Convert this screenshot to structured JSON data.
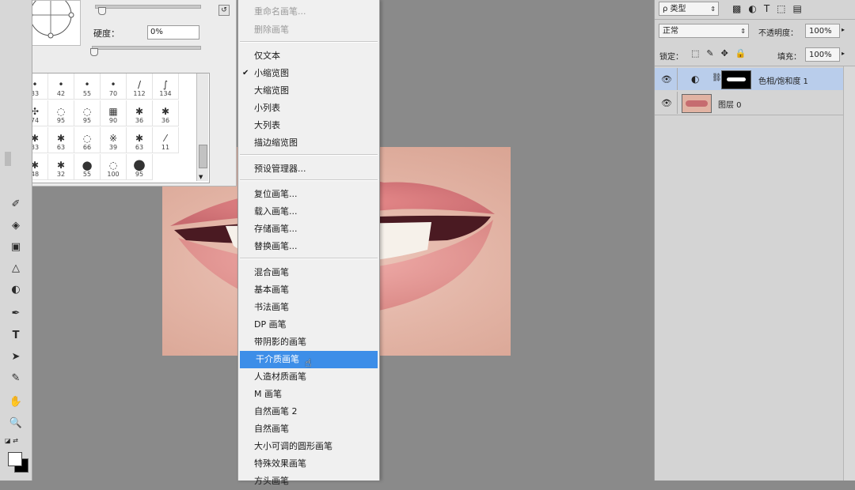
{
  "brush_panel": {
    "hardness_label": "硬度：",
    "hardness_value": "0%",
    "presets": [
      {
        "size": "33",
        "shape": "•"
      },
      {
        "size": "42",
        "shape": "•"
      },
      {
        "size": "55",
        "shape": "•"
      },
      {
        "size": "70",
        "shape": "•"
      },
      {
        "size": "112",
        "shape": "/"
      },
      {
        "size": "134",
        "shape": "∫"
      },
      {
        "size": "74",
        "shape": "✣"
      },
      {
        "size": "95",
        "shape": "◌"
      },
      {
        "size": "95",
        "shape": "◌"
      },
      {
        "size": "90",
        "shape": "▦"
      },
      {
        "size": "36",
        "shape": "✱"
      },
      {
        "size": "36",
        "shape": "✱"
      },
      {
        "size": "33",
        "shape": "✱"
      },
      {
        "size": "63",
        "shape": "✱"
      },
      {
        "size": "66",
        "shape": "◌"
      },
      {
        "size": "39",
        "shape": "※"
      },
      {
        "size": "63",
        "shape": "✱"
      },
      {
        "size": "11",
        "shape": "⁄"
      },
      {
        "size": "48",
        "shape": "✱"
      },
      {
        "size": "32",
        "shape": "✱"
      },
      {
        "size": "55",
        "shape": "●"
      },
      {
        "size": "100",
        "shape": "◌"
      },
      {
        "size": "95",
        "shape": "●"
      }
    ]
  },
  "menu": {
    "items": [
      {
        "label": "重命名画笔...",
        "state": "disabled"
      },
      {
        "label": "删除画笔",
        "state": "disabled"
      },
      {
        "label": "仅文本",
        "state": "normal"
      },
      {
        "label": "小缩览图",
        "state": "checked"
      },
      {
        "label": "大缩览图",
        "state": "normal"
      },
      {
        "label": "小列表",
        "state": "normal"
      },
      {
        "label": "大列表",
        "state": "normal"
      },
      {
        "label": "描边缩览图",
        "state": "normal"
      },
      {
        "label": "预设管理器...",
        "state": "normal"
      },
      {
        "label": "复位画笔...",
        "state": "normal"
      },
      {
        "label": "载入画笔...",
        "state": "normal"
      },
      {
        "label": "存储画笔...",
        "state": "normal"
      },
      {
        "label": "替换画笔...",
        "state": "normal"
      },
      {
        "label": "混合画笔",
        "state": "normal"
      },
      {
        "label": "基本画笔",
        "state": "normal"
      },
      {
        "label": "书法画笔",
        "state": "normal"
      },
      {
        "label": "DP 画笔",
        "state": "normal"
      },
      {
        "label": "带阴影的画笔",
        "state": "normal"
      },
      {
        "label": "干介质画笔",
        "state": "highlighted"
      },
      {
        "label": "人造材质画笔",
        "state": "normal"
      },
      {
        "label": "M 画笔",
        "state": "normal"
      },
      {
        "label": "自然画笔 2",
        "state": "normal"
      },
      {
        "label": "自然画笔",
        "state": "normal"
      },
      {
        "label": "大小可调的圆形画笔",
        "state": "normal"
      },
      {
        "label": "特殊效果画笔",
        "state": "normal"
      },
      {
        "label": "方头画笔",
        "state": "normal"
      }
    ]
  },
  "layers_panel": {
    "filter_kind": "ρ 类型",
    "blend_mode": "正常",
    "opacity_label": "不透明度：",
    "opacity_value": "100%",
    "lock_label": "锁定：",
    "fill_label": "填充：",
    "fill_value": "100%",
    "layers": [
      {
        "name": "色相/饱和度 1",
        "selected": true,
        "type": "adjustment"
      },
      {
        "name": "图层 0",
        "selected": false,
        "type": "pixel"
      }
    ]
  },
  "colors": {
    "menu_highlight": "#3d8ee8",
    "layer_selected": "#b9cdeb",
    "canvas_bg": "#8a8a8a",
    "panel_bg": "#d4d4d4"
  }
}
